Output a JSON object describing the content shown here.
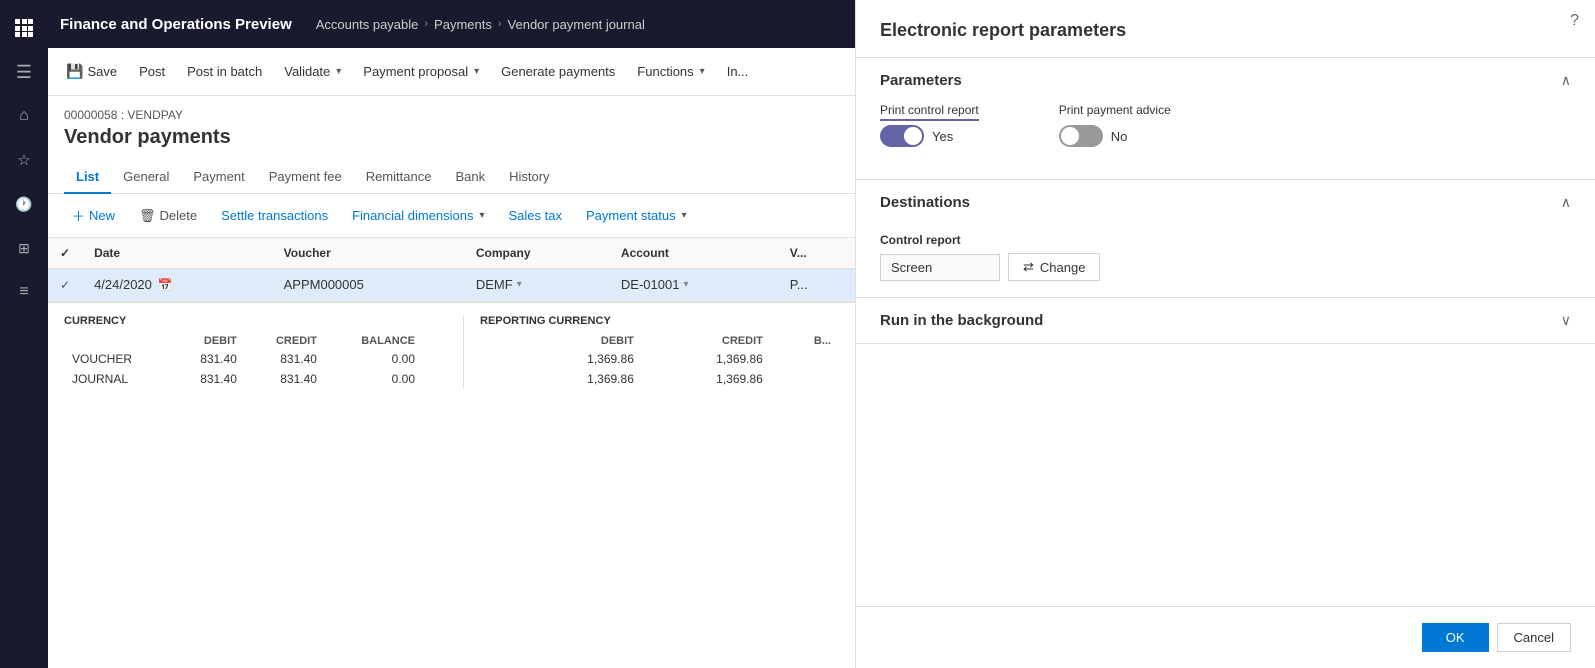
{
  "app": {
    "title": "Finance and Operations Preview",
    "grid_icon": "apps-icon"
  },
  "breadcrumb": {
    "items": [
      "Accounts payable",
      "Payments",
      "Vendor payment journal"
    ]
  },
  "toolbar": {
    "save_label": "Save",
    "post_label": "Post",
    "post_in_batch_label": "Post in batch",
    "validate_label": "Validate",
    "payment_proposal_label": "Payment proposal",
    "generate_payments_label": "Generate payments",
    "functions_label": "Functions",
    "inquiries_label": "In..."
  },
  "sidebar": {
    "icons": [
      {
        "name": "hamburger-icon",
        "symbol": "☰"
      },
      {
        "name": "home-icon",
        "symbol": "⌂"
      },
      {
        "name": "star-icon",
        "symbol": "☆"
      },
      {
        "name": "recent-icon",
        "symbol": "🕐"
      },
      {
        "name": "grid-icon",
        "symbol": "⊞"
      },
      {
        "name": "list-icon",
        "symbol": "≡"
      }
    ]
  },
  "journal": {
    "id": "00000058 : VENDPAY",
    "title": "Vendor payments"
  },
  "tabs": {
    "items": [
      "List",
      "General",
      "Payment",
      "Payment fee",
      "Remittance",
      "Bank",
      "History"
    ],
    "active": "List"
  },
  "grid_toolbar": {
    "new_label": "New",
    "delete_label": "Delete",
    "settle_transactions_label": "Settle transactions",
    "financial_dimensions_label": "Financial dimensions",
    "sales_tax_label": "Sales tax",
    "payment_status_label": "Payment status"
  },
  "grid": {
    "columns": [
      "",
      "Date",
      "Voucher",
      "Company",
      "Account",
      "V..."
    ],
    "rows": [
      {
        "selected": true,
        "date": "4/24/2020",
        "voucher": "APPM000005",
        "company": "DEMF",
        "account": "DE-01001",
        "extra": "P..."
      }
    ]
  },
  "summary": {
    "currency_label": "CURRENCY",
    "reporting_currency_label": "REPORTING CURRENCY",
    "col_debit": "DEBIT",
    "col_credit": "CREDIT",
    "col_balance": "BALANCE",
    "rows": [
      {
        "label": "VOUCHER",
        "debit": "831.40",
        "credit": "831.40",
        "balance": "0.00",
        "rep_debit": "1,369.86",
        "rep_credit": "1,369.86"
      },
      {
        "label": "JOURNAL",
        "debit": "831.40",
        "credit": "831.40",
        "balance": "0.00",
        "rep_debit": "1,369.86",
        "rep_credit": "1,369.86"
      }
    ]
  },
  "right_panel": {
    "title": "Electronic report parameters",
    "help_icon": "question-mark-icon",
    "parameters_section": {
      "title": "Parameters",
      "print_control_report": {
        "label": "Print control report",
        "value_on": true,
        "value_label": "Yes"
      },
      "print_payment_advice": {
        "label": "Print payment advice",
        "value_on": false,
        "value_label": "No"
      }
    },
    "destinations_section": {
      "title": "Destinations",
      "control_report_label": "Control report",
      "control_report_value": "Screen",
      "change_btn_label": "Change",
      "change_icon": "arrows-icon"
    },
    "run_in_background_section": {
      "title": "Run in the background"
    },
    "footer": {
      "ok_label": "OK",
      "cancel_label": "Cancel"
    }
  }
}
